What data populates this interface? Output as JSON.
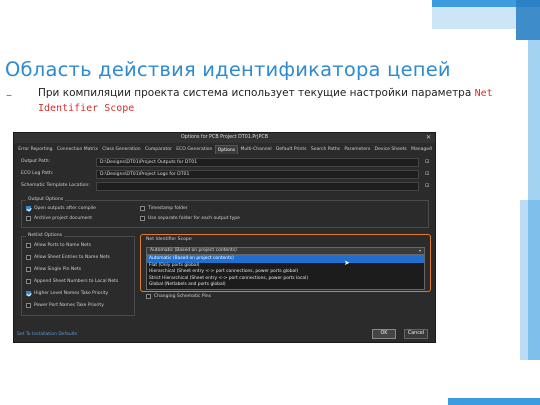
{
  "slide": {
    "title": "Область действия идентификатора цепей",
    "bullet_marker": "–",
    "bullet_text": "При компиляции проекта система использует текущие настройки параметра",
    "bullet_highlight": "Net Identifier Scope"
  },
  "dialog": {
    "title": "Options for PCB Project DT01.PrjPCB",
    "close_glyph": "✕",
    "tabs": [
      "Error Reporting",
      "Connection Matrix",
      "Class Generation",
      "Comparator",
      "ECO Generation",
      "Options",
      "Multi-Channel",
      "Default Prints",
      "Search Paths",
      "Parameters",
      "Device Sheets",
      "Managed"
    ],
    "active_tab": "Options",
    "tabs_chevron": "›",
    "fields": {
      "output_path": {
        "label": "Output Path:",
        "value": "D:\\Designs\\DT01\\Project Outputs for DT01"
      },
      "eco_log_path": {
        "label": "ECO Log Path:",
        "value": "D:\\Designs\\DT01\\Project Logs for DT01"
      },
      "schematic_template": {
        "label": "Schematic Template Location:",
        "value": ""
      },
      "folder_glyph": "⊡"
    },
    "output_options": {
      "title": "Output Options",
      "items": [
        {
          "label": "Open outputs after compile",
          "checked": true
        },
        {
          "label": "Timestamp folder",
          "checked": false
        },
        {
          "label": "Archive project document",
          "checked": false
        },
        {
          "label": "Use separate folder for each output type",
          "checked": false
        }
      ]
    },
    "netlist_options": {
      "title": "Netlist Options",
      "items": [
        {
          "label": "Allow Ports to Name Nets",
          "checked": false
        },
        {
          "label": "Allow Sheet Entries to Name Nets",
          "checked": false
        },
        {
          "label": "Allow Single Pin Nets",
          "checked": false
        },
        {
          "label": "Append Sheet Numbers to Local Nets",
          "checked": false
        },
        {
          "label": "Higher Level Names Take Priority",
          "checked": true
        },
        {
          "label": "Power Port Names Take Priority",
          "checked": false
        }
      ]
    },
    "net_identifier_scope": {
      "title": "Net Identifier Scope",
      "selected": "Automatic (Based on project contents)",
      "arrow": "▾",
      "options": [
        "Automatic (Based on project contents)",
        "Flat (Only ports global)",
        "Hierarchical (Sheet entry <-> port connections, power ports global)",
        "Strict Hierarchical (Sheet entry <-> port connections, power ports local)",
        "Global (Netlabels and ports global)"
      ],
      "highlighted_index": 0,
      "partial_option": "Changing Schematic Pins"
    },
    "footer": {
      "link": "Set To Installation Defaults",
      "ok": "OK",
      "cancel": "Cancel"
    }
  }
}
